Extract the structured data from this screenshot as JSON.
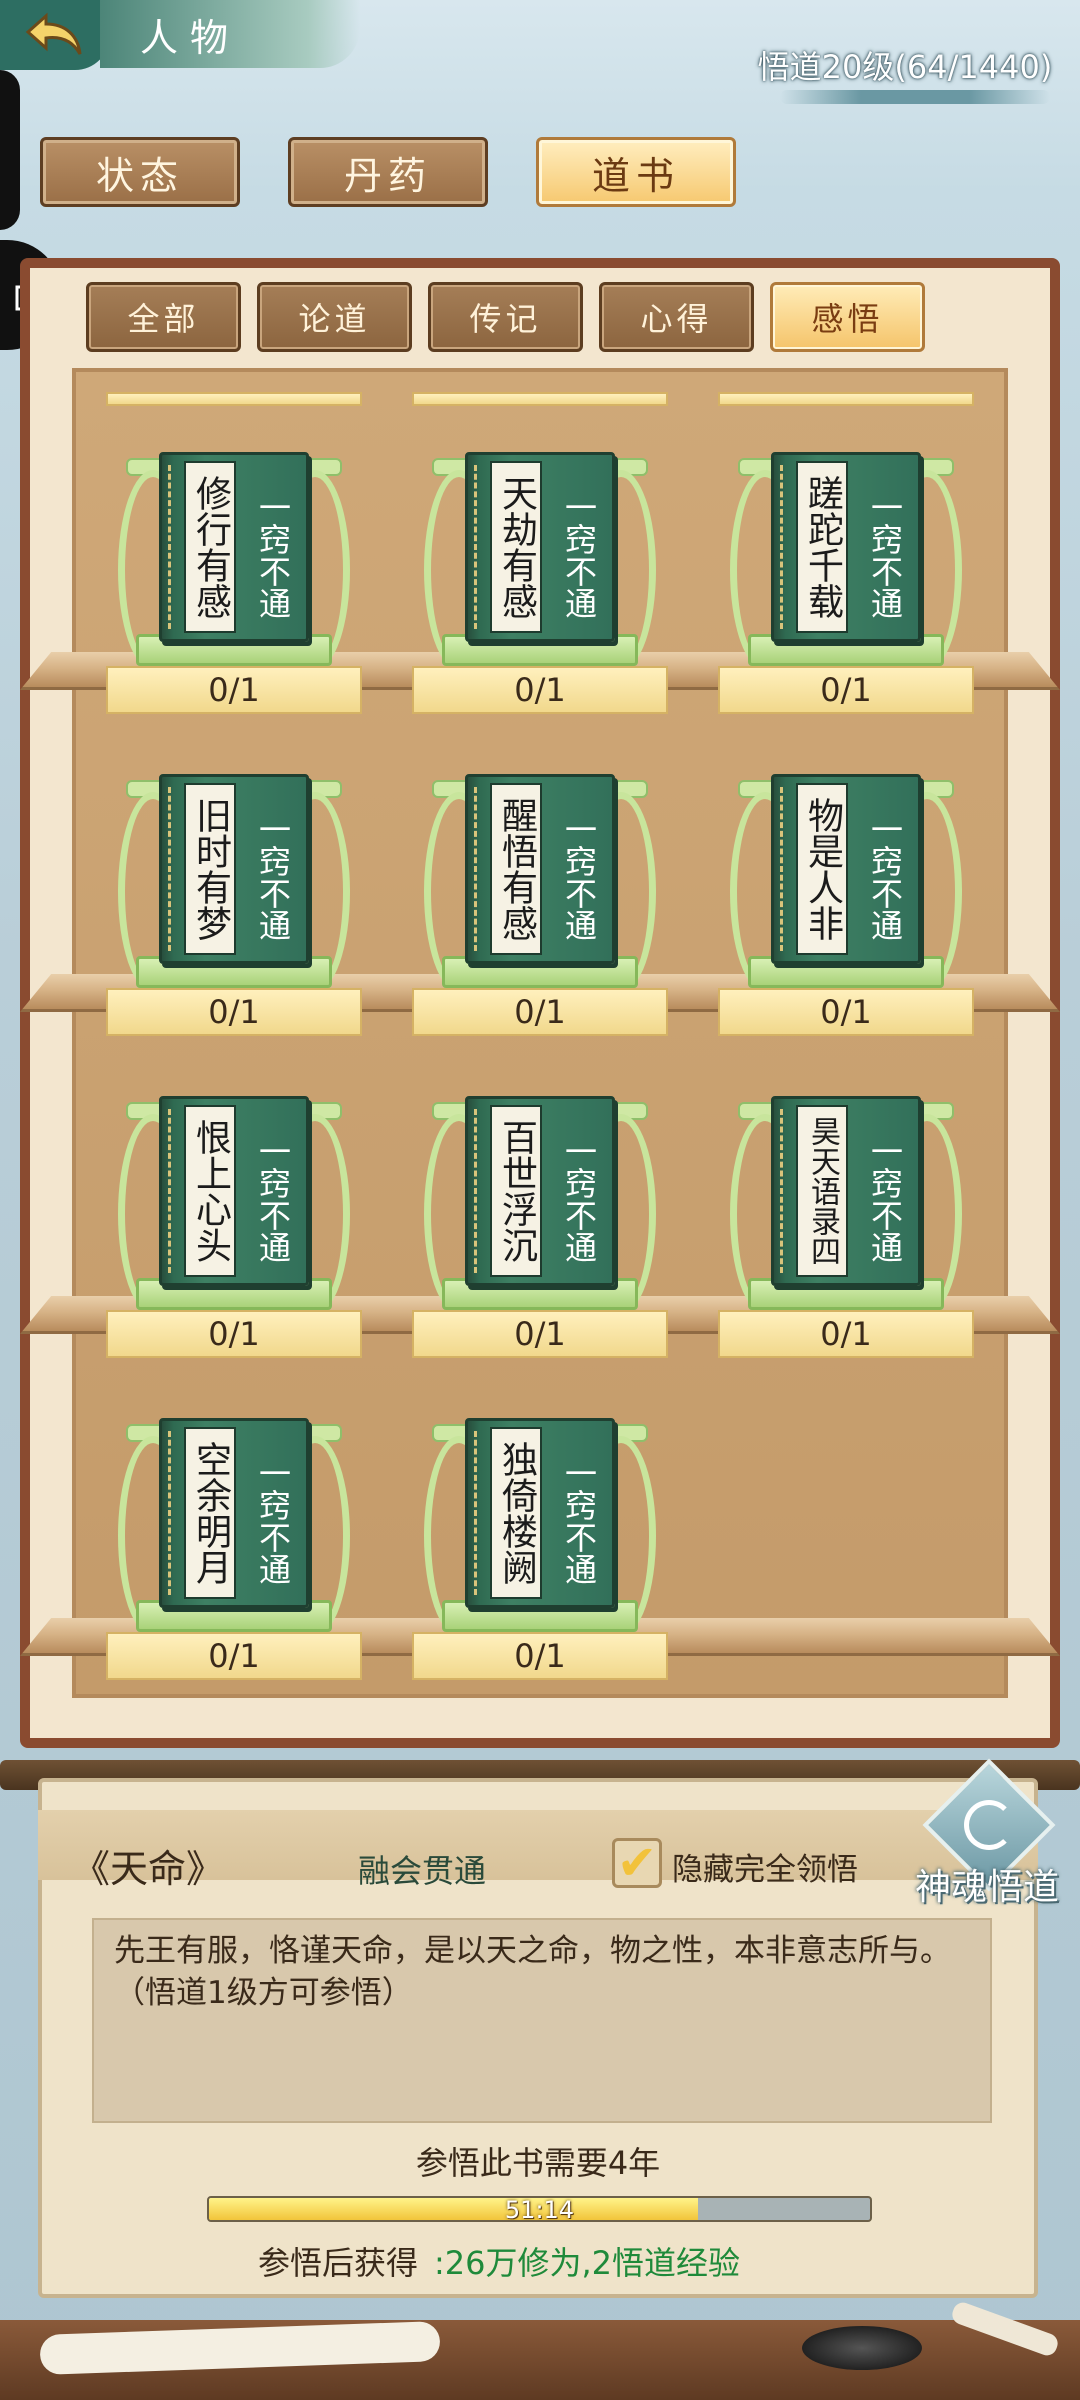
{
  "header": {
    "title": "人物",
    "level_text": "悟道20级(64/1440)"
  },
  "top_tabs": [
    {
      "label": "状态",
      "active": false
    },
    {
      "label": "丹药",
      "active": false
    },
    {
      "label": "道书",
      "active": true
    }
  ],
  "filter_tabs": [
    {
      "label": "全部",
      "active": false
    },
    {
      "label": "论道",
      "active": false
    },
    {
      "label": "传记",
      "active": false
    },
    {
      "label": "心得",
      "active": false
    },
    {
      "label": "感悟",
      "active": true
    }
  ],
  "books": [
    {
      "name": "修行有感",
      "level": "一窍不通",
      "count": "0/1"
    },
    {
      "name": "天劫有感",
      "level": "一窍不通",
      "count": "0/1"
    },
    {
      "name": "蹉跎千载",
      "level": "一窍不通",
      "count": "0/1"
    },
    {
      "name": "旧时有梦",
      "level": "一窍不通",
      "count": "0/1"
    },
    {
      "name": "醒悟有感",
      "level": "一窍不通",
      "count": "0/1"
    },
    {
      "name": "物是人非",
      "level": "一窍不通",
      "count": "0/1"
    },
    {
      "name": "恨上心头",
      "level": "一窍不通",
      "count": "0/1"
    },
    {
      "name": "百世浮沉",
      "level": "一窍不通",
      "count": "0/1"
    },
    {
      "name": "昊天语录四",
      "level": "一窍不通",
      "count": "0/1"
    },
    {
      "name": "空余明月",
      "level": "一窍不通",
      "count": "0/1"
    },
    {
      "name": "独倚楼阙",
      "level": "一窍不通",
      "count": "0/1"
    }
  ],
  "detail": {
    "book_title": "《天命》",
    "mastery": "融会贯通",
    "hide_label": "隐藏完全领悟",
    "hide_checked": true,
    "soul_button": "神魂悟道",
    "description": "先王有服，恪谨天命，是以天之命，物之性，本非意志所与。（悟道1级方可参悟）",
    "study_time": "参悟此书需要4年",
    "progress_text": "51:14",
    "progress_fraction": 0.74,
    "reward_label": "参悟后获得",
    "reward_value": ":26万修为,2悟道经验"
  },
  "icons": {
    "back": "back-arrow-icon",
    "side": "puzzle-icon",
    "check": "checkmark-icon",
    "soul": "soul-swirl-icon"
  }
}
